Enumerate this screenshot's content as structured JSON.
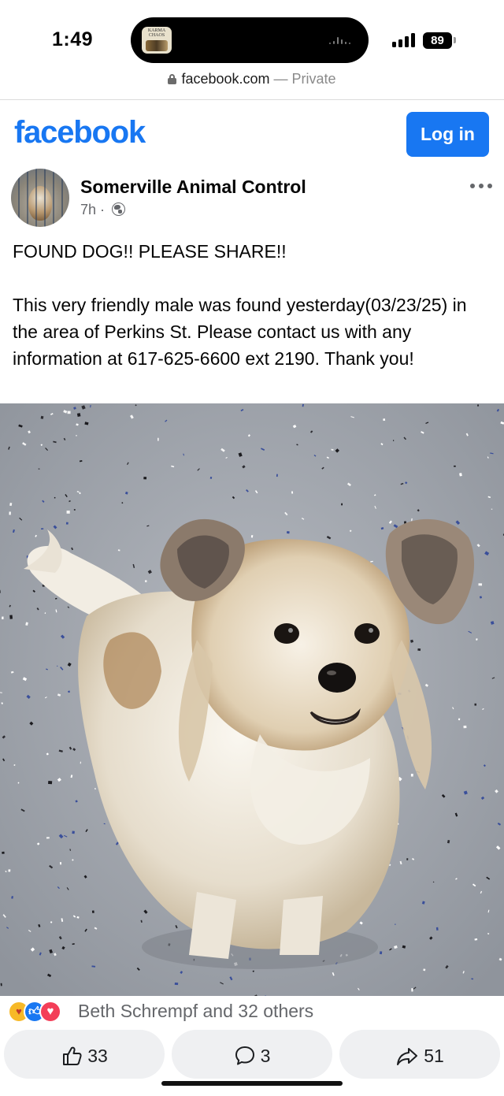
{
  "status_bar": {
    "time": "1:49",
    "battery": "89",
    "now_playing_art_text": "KARMA CHAOS"
  },
  "browser": {
    "domain": "facebook.com",
    "separator": "—",
    "privacy": "Private"
  },
  "header": {
    "logo": "facebook",
    "login_label": "Log in",
    "brand_color": "#1877f2"
  },
  "post": {
    "author": "Somerville Animal Control",
    "time_ago": "7h",
    "meta_separator": "·",
    "audience_icon": "globe-icon",
    "headline": "FOUND DOG!! PLEASE SHARE!!",
    "body": "This very friendly male was found yesterday(03/23/25) in the area of Perkins St. Please contact us with any information at 617-625-6600 ext 2190. Thank you!",
    "reactions_text": "Beth Schrempf and 32 others",
    "reaction_icons": [
      "care-reaction-icon",
      "like-reaction-icon",
      "love-reaction-icon"
    ],
    "likes": "33",
    "comments": "3",
    "shares": "51"
  }
}
